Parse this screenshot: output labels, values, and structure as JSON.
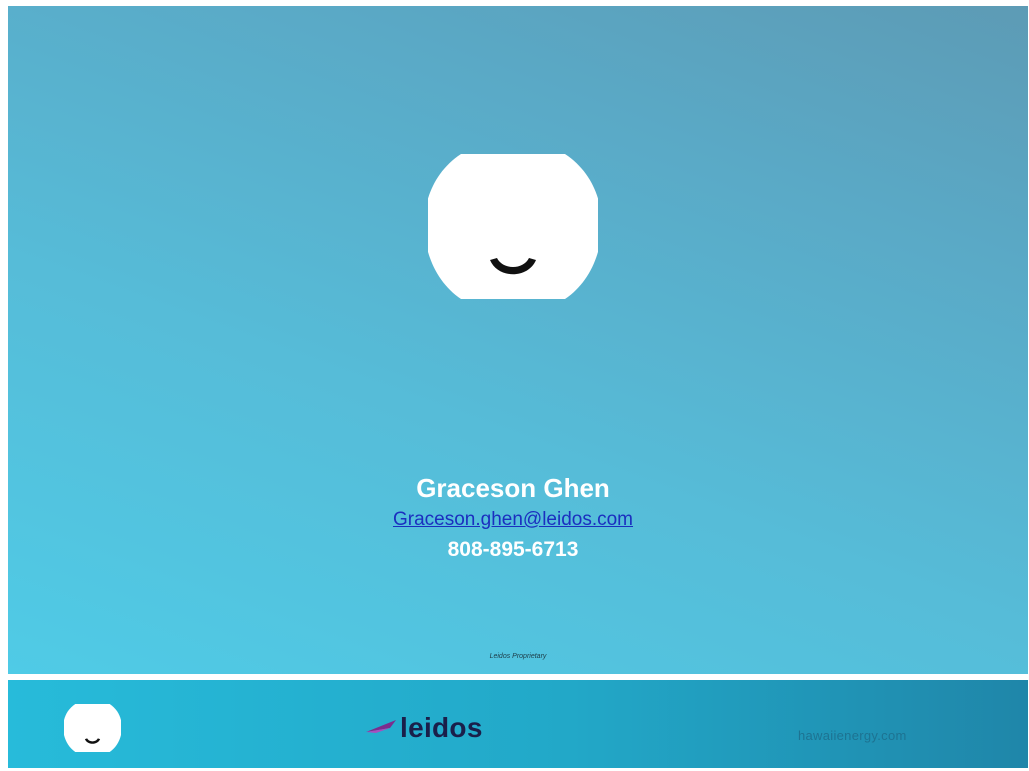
{
  "slide": {
    "logo": "hawaii-energy-logo",
    "contact": {
      "name": "Graceson Ghen",
      "email": "Graceson.ghen@leidos.com",
      "phone": "808-895-6713"
    },
    "footer_note": "Leidos Proprietary"
  },
  "footer": {
    "left_logo": "hawaii-energy-logo",
    "brand": "leidos",
    "site": "hawaiienergy.com"
  },
  "colors": {
    "slide_gradient": [
      "#4fcbe6",
      "#5d9bb5"
    ],
    "footer_gradient": [
      "#27bbda",
      "#1f86a9"
    ],
    "email_link": "#1b2fbf",
    "leidos_text": "#1a1f4a",
    "leidos_mark": "#7b2d8e"
  }
}
